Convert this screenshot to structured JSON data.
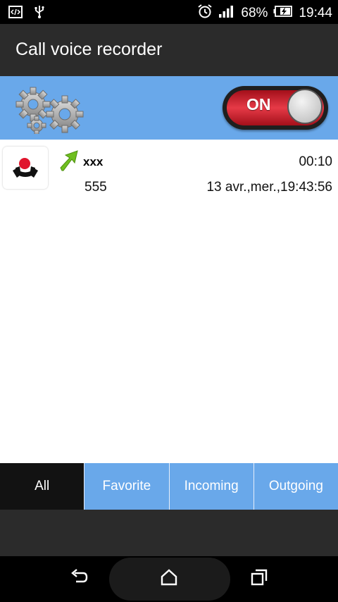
{
  "status_bar": {
    "battery_percent": "68%",
    "time": "19:44",
    "icons": [
      "code-icon",
      "usb-icon",
      "alarm-icon",
      "signal-icon",
      "battery-charging-icon"
    ]
  },
  "app_bar": {
    "title": "Call voice recorder"
  },
  "banner": {
    "settings_icon": "gears-icon",
    "toggle_label": "ON",
    "toggle_state": true,
    "background_color": "#69a8ea"
  },
  "recordings": [
    {
      "name": "xxx",
      "duration": "00:10",
      "number": "555",
      "datetime": "13 avr.,mer.,19:43:56",
      "direction_icon": "outgoing-arrow-icon"
    }
  ],
  "tabs": [
    {
      "label": "All",
      "active": true
    },
    {
      "label": "Favorite",
      "active": false
    },
    {
      "label": "Incoming",
      "active": false
    },
    {
      "label": "Outgoing",
      "active": false
    }
  ],
  "nav_bar": {
    "icons": [
      "back-icon",
      "home-icon",
      "recents-icon"
    ]
  }
}
